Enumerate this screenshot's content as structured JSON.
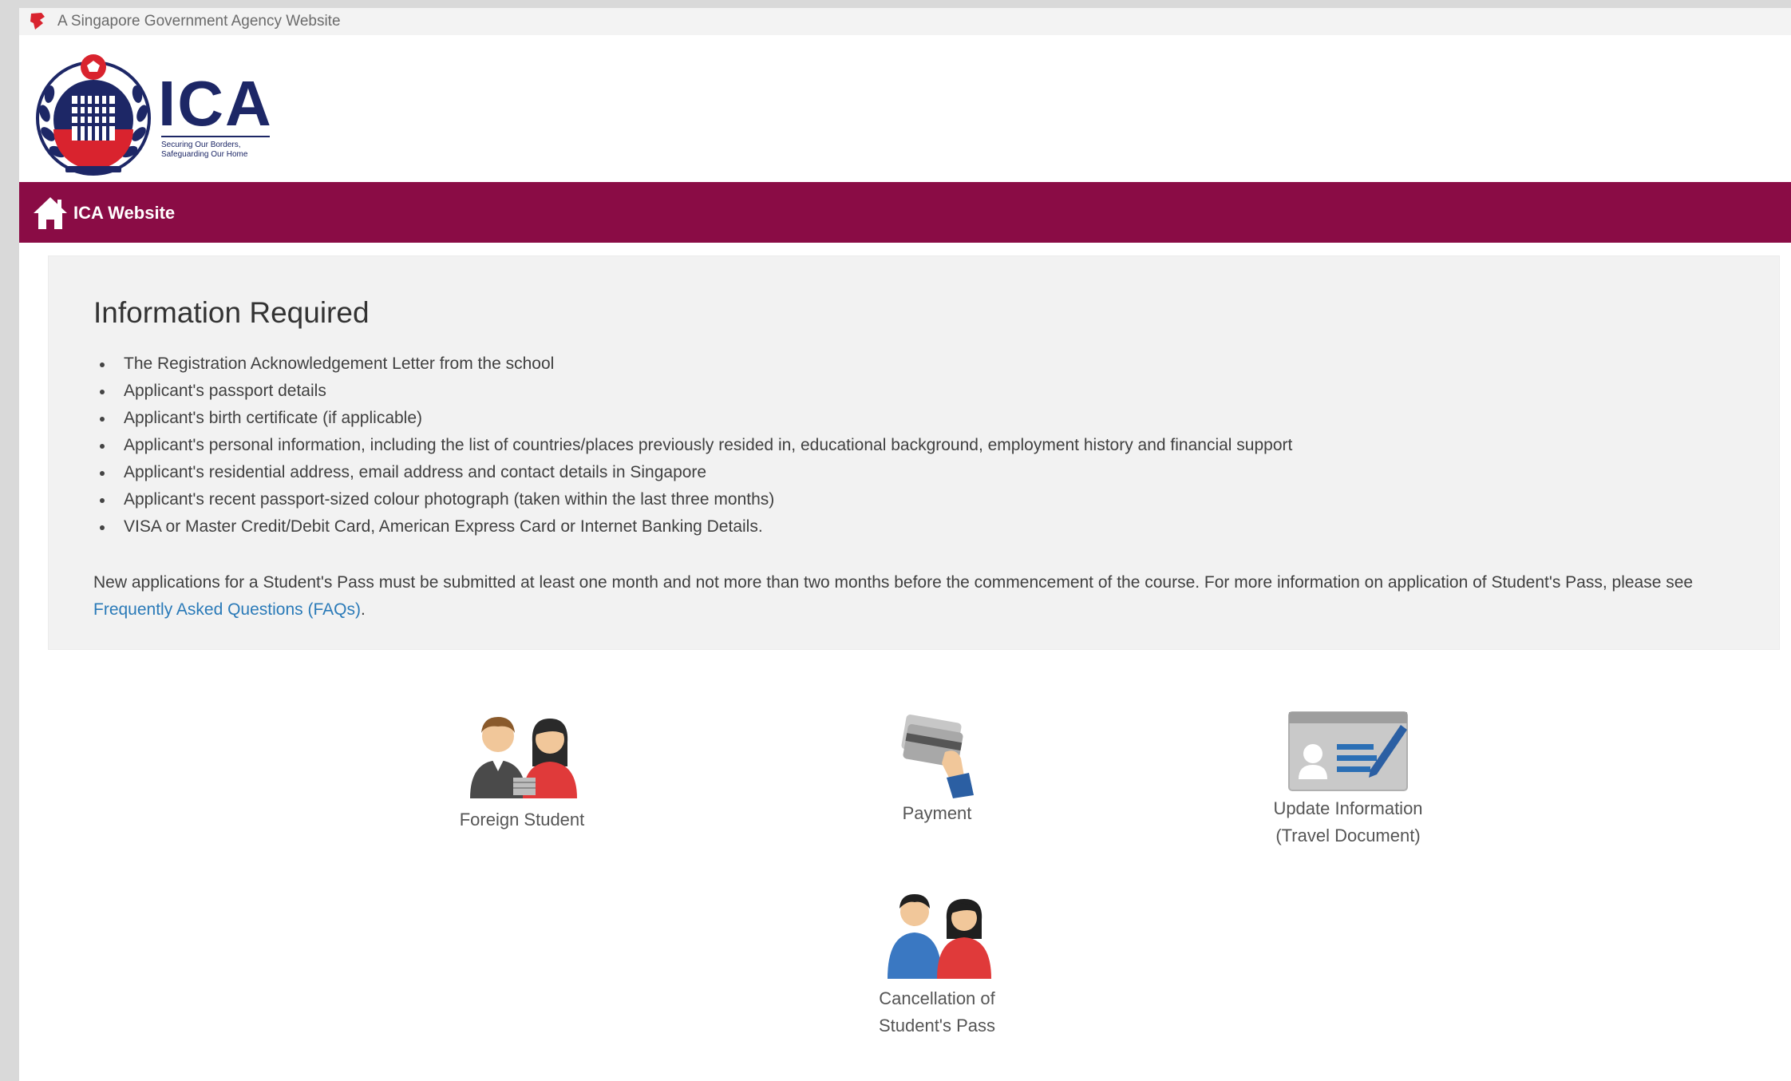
{
  "top_banner": {
    "text": "A Singapore Government Agency Website"
  },
  "logo": {
    "name": "ICA",
    "tagline_line1": "Securing Our Borders,",
    "tagline_line2": "Safeguarding Our Home"
  },
  "nav": {
    "home_label": "ICA Website"
  },
  "info": {
    "title": "Information Required",
    "items": [
      "The Registration Acknowledgement Letter from the school",
      "Applicant's passport details",
      "Applicant's birth certificate (if applicable)",
      "Applicant's personal information, including the list of countries/places previously resided in, educational background, employment history and financial support",
      "Applicant's residential address, email address and contact details in Singapore",
      "Applicant's recent passport-sized colour photograph (taken within the last three months)",
      "VISA or Master Credit/Debit Card, American Express Card or Internet Banking Details."
    ],
    "note_text": "New applications for a Student's Pass must be submitted at least one month and not more than two months before the commencement of the course. For more information on application of Student's Pass, please see ",
    "note_link": "Frequently Asked Questions (FAQs)",
    "note_end": "."
  },
  "services": {
    "foreign_student": "Foreign Student",
    "payment": "Payment",
    "update_line1": "Update Information",
    "update_line2": "(Travel Document)",
    "cancel_line1": "Cancellation of",
    "cancel_line2": "Student's Pass"
  },
  "colors": {
    "nav_bar": "#8a0c45",
    "logo_navy": "#1d2766",
    "link": "#2a7ab8"
  },
  "icons": {
    "banner": "lion-head-icon",
    "home": "home-icon",
    "foreign_student": "students-icon",
    "payment": "card-payment-icon",
    "update": "id-card-edit-icon",
    "cancel": "students-cancel-icon"
  }
}
